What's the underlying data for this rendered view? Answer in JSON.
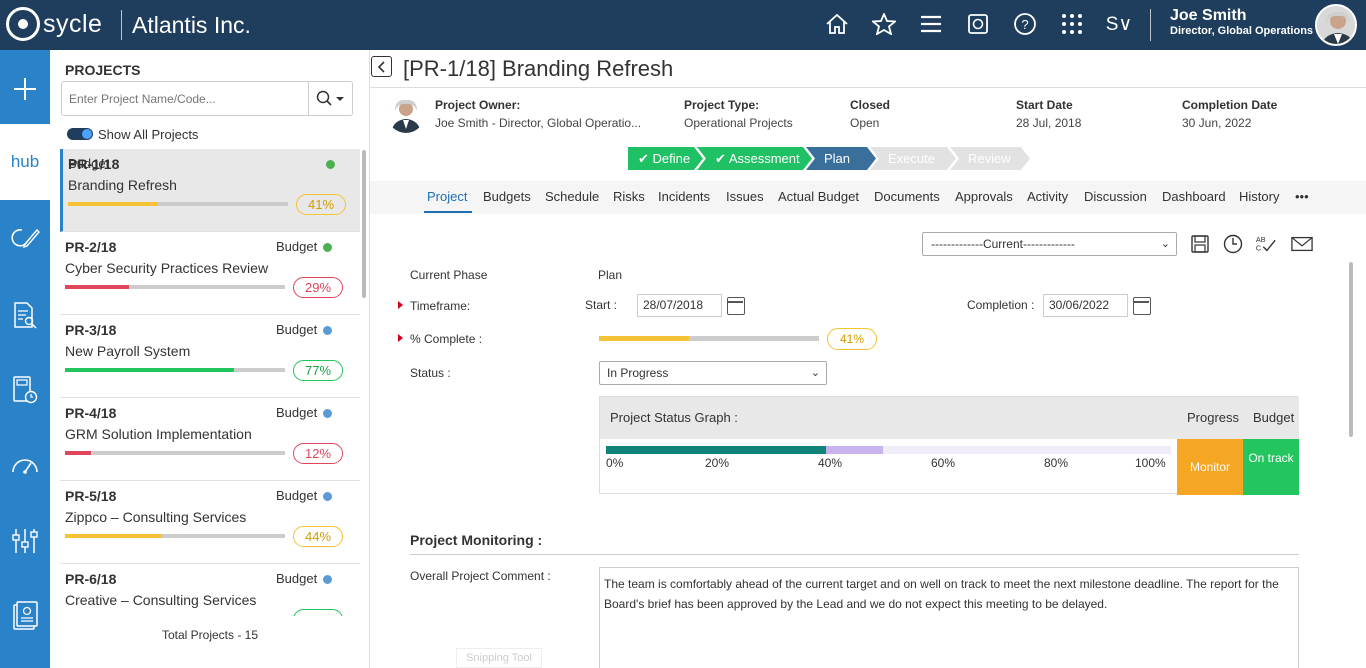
{
  "app": {
    "logo_text": "sycle",
    "company": "Atlantis Inc."
  },
  "topbar": {
    "icons": [
      "home-icon",
      "star-icon",
      "menu-icon",
      "dashboard-icon",
      "help-icon",
      "apps-grid-icon",
      "s-dropdown"
    ],
    "s_label": "S∨",
    "user_name": "Joe Smith",
    "user_role": "Director, Global Operations"
  },
  "leftnav": {
    "hub_label": "hub",
    "items": [
      "add-icon",
      "hub",
      "refresh-edit-icon",
      "document-search-icon",
      "calculator-clock-icon",
      "gauge-icon",
      "sliders-icon",
      "report-icon"
    ]
  },
  "projects_panel": {
    "title": "PROJECTS",
    "search_placeholder": "Enter Project Name/Code...",
    "show_all_label": "Show All Projects",
    "total": "Total Projects - 15",
    "items": [
      {
        "code": "PR-1/18",
        "name": "Branding Refresh",
        "budget_label": "Budget",
        "dot_color": "#4caf50",
        "progress": 41,
        "pct_label": "41%",
        "bar_color": "#f6c236",
        "pill_color": "#f6c236",
        "text_color": "#d39c00",
        "selected": true
      },
      {
        "code": "PR-2/18",
        "name": "Cyber Security Practices Review",
        "budget_label": "Budget",
        "dot_color": "#4caf50",
        "progress": 29,
        "pct_label": "29%",
        "bar_color": "#e0455a",
        "pill_color": "#e0455a",
        "text_color": "#e0455a",
        "selected": false
      },
      {
        "code": "PR-3/18",
        "name": "New Payroll System",
        "budget_label": "Budget",
        "dot_color": "#5b9bd5",
        "progress": 77,
        "pct_label": "77%",
        "bar_color": "#22c55e",
        "pill_color": "#22c55e",
        "text_color": "#16a34a",
        "selected": false
      },
      {
        "code": "PR-4/18",
        "name": "GRM Solution Implementation",
        "budget_label": "Budget",
        "dot_color": "#5b9bd5",
        "progress": 12,
        "pct_label": "12%",
        "bar_color": "#e0455a",
        "pill_color": "#e0455a",
        "text_color": "#e0455a",
        "selected": false
      },
      {
        "code": "PR-5/18",
        "name": "Zippco – Consulting Services",
        "budget_label": "Budget",
        "dot_color": "#5b9bd5",
        "progress": 44,
        "pct_label": "44%",
        "bar_color": "#f6c236",
        "pill_color": "#f6c236",
        "text_color": "#d39c00",
        "selected": false
      },
      {
        "code": "PR-6/18",
        "name": "Creative – Consulting Services",
        "budget_label": "Budget",
        "dot_color": "#5b9bd5",
        "progress": 0,
        "pct_label": "",
        "bar_color": "#22c55e",
        "pill_color": "#22c55e",
        "text_color": "#16a34a",
        "selected": false
      }
    ]
  },
  "project": {
    "title": "[PR-1/18] Branding Refresh",
    "owner_label": "Project Owner:",
    "owner_value": "Joe Smith - Director, Global Operatio...",
    "type_label": "Project Type:",
    "type_value": "Operational Projects",
    "closed_label": "Closed",
    "closed_value": "Open",
    "start_label": "Start Date",
    "start_value": "28 Jul, 2018",
    "completion_label": "Completion Date",
    "completion_value": "30 Jun, 2022"
  },
  "phases": [
    {
      "label": "Define",
      "state": "done",
      "check": "✔"
    },
    {
      "label": "Assessment",
      "state": "done",
      "check": "✔"
    },
    {
      "label": "Plan",
      "state": "current",
      "check": ""
    },
    {
      "label": "Execute",
      "state": "future",
      "check": ""
    },
    {
      "label": "Review",
      "state": "future",
      "check": ""
    }
  ],
  "tabs": [
    "Project",
    "Budgets",
    "Schedule",
    "Risks",
    "Incidents",
    "Issues",
    "Actual Budget",
    "Documents",
    "Approvals",
    "Activity",
    "Discussion",
    "Dashboard",
    "History",
    "•••"
  ],
  "version_select": "-------------Current-------------",
  "form": {
    "current_phase_label": "Current Phase",
    "current_phase_value": "Plan",
    "timeframe_label": "Timeframe:",
    "start_label": "Start :",
    "start_value": "28/07/2018",
    "completion_label": "Completion :",
    "completion_value": "30/06/2022",
    "complete_label": "% Complete :",
    "complete_value": 41,
    "complete_pct": "41%",
    "status_label": "Status :",
    "status_value": "In Progress"
  },
  "graph": {
    "title": "Project Status Graph :",
    "progress_label": "Progress",
    "budget_label": "Budget",
    "ticks": [
      "0%",
      "20%",
      "40%",
      "60%",
      "80%",
      "100%"
    ],
    "actual_pct": 39,
    "planned_pct": 49,
    "progress_status": "Monitor",
    "budget_status": "On track"
  },
  "monitoring": {
    "title": "Project Monitoring :",
    "comment_label": "Overall Project Comment :",
    "comment": "The team is comfortably ahead of the current target and on well on track to meet the next milestone deadline. The report for the Board's brief has been approved by the Lead and we do not expect this meeting to be delayed."
  },
  "snipping_tool": "Snipping Tool"
}
